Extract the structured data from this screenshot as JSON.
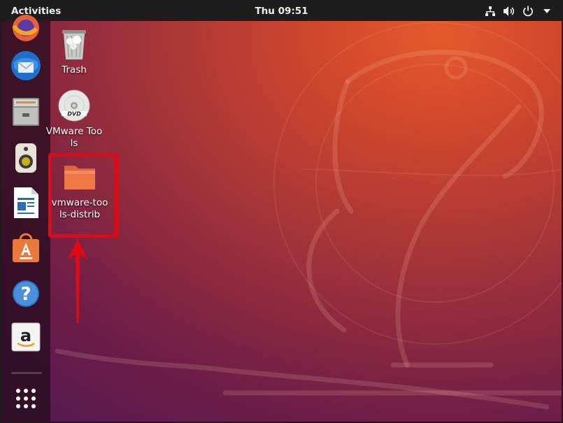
{
  "topbar": {
    "activities_label": "Activities",
    "clock": "Thu 09:51",
    "tray_icons": [
      "network-icon",
      "volume-icon",
      "power-icon",
      "chevron-down-icon"
    ]
  },
  "dock": {
    "items": [
      {
        "name": "firefox",
        "icon": "firefox-icon"
      },
      {
        "name": "thunderbird",
        "icon": "thunderbird-icon"
      },
      {
        "name": "files",
        "icon": "files-icon"
      },
      {
        "name": "rhythmbox",
        "icon": "rhythmbox-icon"
      },
      {
        "name": "libreoffice-writer",
        "icon": "writer-icon"
      },
      {
        "name": "ubuntu-software",
        "icon": "software-icon"
      },
      {
        "name": "help",
        "icon": "help-icon"
      },
      {
        "name": "amazon",
        "icon": "amazon-icon"
      },
      {
        "name": "show-applications",
        "icon": "app-grid-icon"
      }
    ]
  },
  "desktop": {
    "icons": [
      {
        "label": "Trash",
        "icon": "trash-icon"
      },
      {
        "label": "VMware Tools",
        "icon": "dvd-icon"
      },
      {
        "label": "vmware-tools-distrib",
        "icon": "folder-icon",
        "highlighted": true
      }
    ]
  },
  "annotation": {
    "box_color": "#e00b12",
    "arrow_color": "#e00b12"
  },
  "colors": {
    "topbar_bg": "#1d1d1d",
    "wallpaper_orange": "#e45a2c",
    "wallpaper_purple": "#571a4f",
    "folder_orange": "#f07746"
  }
}
